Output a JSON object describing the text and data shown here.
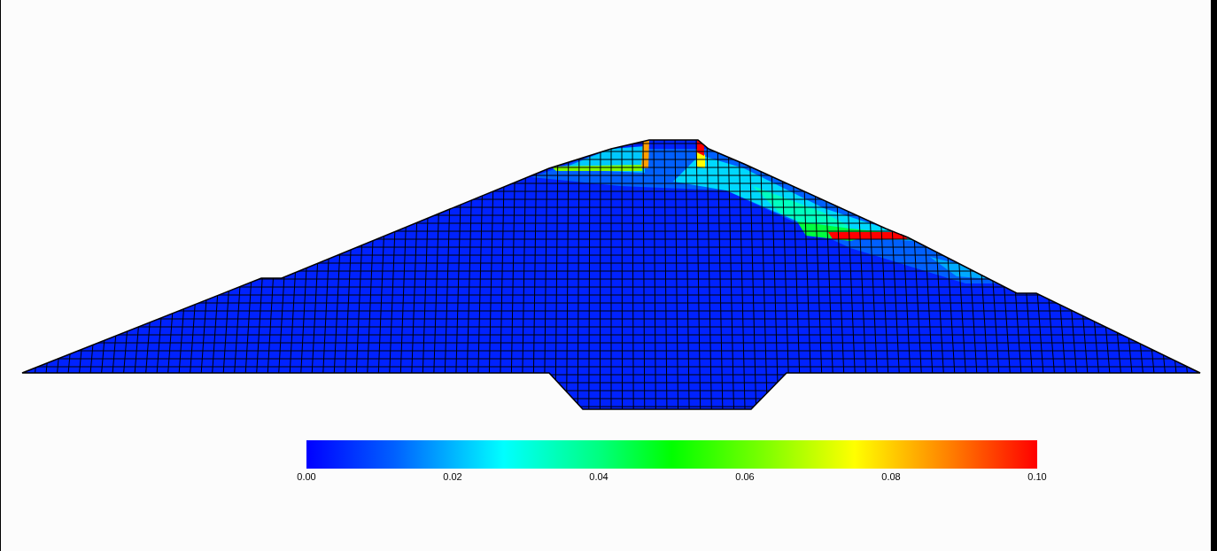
{
  "color_scale": {
    "ticks": [
      "0.00",
      "0.02",
      "0.04",
      "0.06",
      "0.08",
      "0.10"
    ]
  }
}
